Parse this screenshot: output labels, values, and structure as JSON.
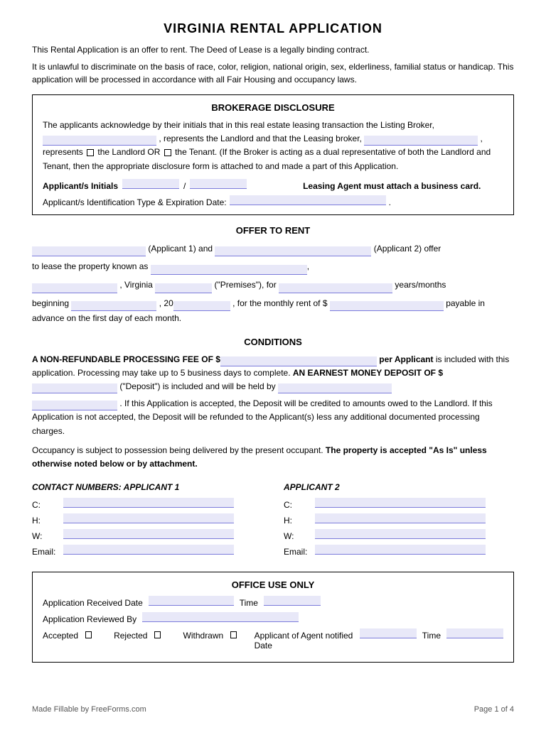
{
  "title": "VIRGINIA RENTAL APPLICATION",
  "intro": [
    "This Rental Application is an offer to rent. The Deed of Lease is a legally binding contract.",
    "It is unlawful to discriminate on the basis of race, color, religion, national origin, sex, elderliness, familial status or handicap. This application will be processed in accordance with all Fair Housing and occupancy laws."
  ],
  "brokerage": {
    "title": "BROKERAGE DISCLOSURE",
    "body1": "The applicants acknowledge by their initials that in this real estate leasing transaction the Listing Broker,",
    "body2": ", represents the Landlord and that the Leasing broker,",
    "body3": ", represents",
    "checkbox_landlord": "the Landlord OR",
    "checkbox_tenant": "the Tenant. (If the Broker is acting as a dual representative of both the Landlord and Tenant, then the appropriate disclosure form is attached to and made a part of this Application.",
    "initials_label": "Applicant/s Initials",
    "leasing_label": "Leasing Agent must attach a business card.",
    "id_label": "Applicant/s Identification Type & Expiration Date:"
  },
  "offer": {
    "title": "OFFER TO RENT",
    "applicant1_label": "(Applicant 1) and",
    "applicant2_label": "(Applicant 2) offer",
    "lease_text": "to lease the property known as",
    "virginia_label": ", Virginia",
    "premises_label": "(\"Premises\"), for",
    "years_months": "years/months",
    "beginning_label": "beginning",
    "year_label": ", 20",
    "rent_label": ", for the monthly rent of $",
    "payable_label": "payable in advance on the first day of each month."
  },
  "conditions": {
    "title": "CONDITIONS",
    "para1_a": "A NON-REFUNDABLE PROCESSING FEE OF $",
    "para1_b": "per Applicant is included with this application. Processing may take up to 5 business days to complete. AN EARNEST MONEY DEPOSIT OF $",
    "para1_c": "(\"Deposit\") is included and will be held by",
    "para1_d": ". If this Application is accepted, the Deposit will be credited to amounts owed to the Landlord. If this Application is not accepted, the Deposit will be refunded to the Applicant(s) less any additional documented processing charges.",
    "para2": "Occupancy is subject to possession being delivered by the present occupant.",
    "para2_bold": "The property is accepted \"As Is\" unless otherwise noted below or by attachment."
  },
  "contacts": {
    "applicant1_title": "CONTACT NUMBERS: APPLICANT 1",
    "applicant2_title": "APPLICANT 2",
    "fields": [
      "C:",
      "H:",
      "W:",
      "Email:"
    ]
  },
  "office": {
    "title": "OFFICE USE ONLY",
    "received_label": "Application Received Date",
    "time_label": "Time",
    "reviewed_label": "Application Reviewed By",
    "accepted_label": "Accepted",
    "rejected_label": "Rejected",
    "withdrawn_label": "Withdrawn",
    "notified_label": "Applicant of Agent notified  Date",
    "time2_label": "Time"
  },
  "footer": {
    "left": "Made Fillable by FreeForms.com",
    "right": "Page 1 of 4"
  }
}
